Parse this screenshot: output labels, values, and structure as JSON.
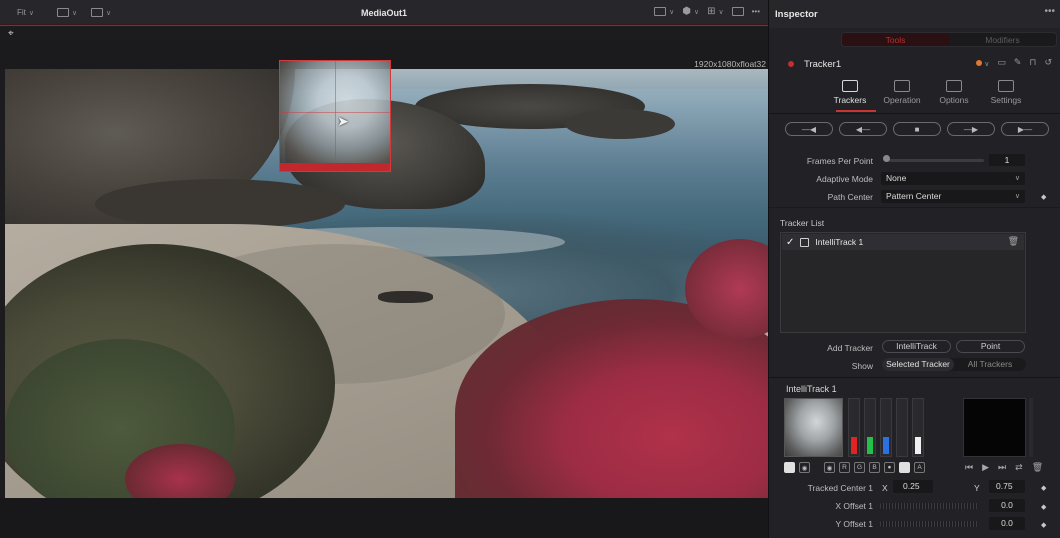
{
  "viewer": {
    "fit_label": "Fit",
    "title": "MediaOut1",
    "more_label": "•••",
    "resolution": "1920x1080xfloat32"
  },
  "inspector": {
    "title": "Inspector",
    "more_label": "•••",
    "tabs": [
      {
        "label": "Tools",
        "active": true
      },
      {
        "label": "Modifiers",
        "active": false
      }
    ],
    "node_name": "Tracker1",
    "subtabs": [
      {
        "label": "Trackers",
        "icon": "target-icon",
        "active": true
      },
      {
        "label": "Operation",
        "icon": "operation-icon",
        "active": false
      },
      {
        "label": "Options",
        "icon": "monitor-icon",
        "active": false
      },
      {
        "label": "Settings",
        "icon": "settings-icon",
        "active": false
      }
    ],
    "track_buttons": [
      {
        "name": "track-reverse-from-end",
        "glyph": "—◀"
      },
      {
        "name": "track-reverse",
        "glyph": "◀—"
      },
      {
        "name": "stop-tracking",
        "glyph": "■"
      },
      {
        "name": "track-forward",
        "glyph": "—▶"
      },
      {
        "name": "track-forward-from-start",
        "glyph": "▶—"
      }
    ],
    "frames_per_point": {
      "label": "Frames Per Point",
      "value": "1"
    },
    "adaptive_mode": {
      "label": "Adaptive Mode",
      "value": "None"
    },
    "path_center": {
      "label": "Path Center",
      "value": "Pattern Center"
    },
    "tracker_list": {
      "label": "Tracker List",
      "items": [
        {
          "name": "IntelliTrack 1",
          "checked": true
        }
      ]
    },
    "add_tracker": {
      "label": "Add Tracker",
      "intellitrack": "IntelliTrack",
      "point": "Point"
    },
    "show": {
      "label": "Show",
      "selected": "Selected Tracker",
      "all": "All Trackers"
    },
    "intellitrack": {
      "title": "IntelliTrack 1",
      "channel_letters": [
        "R",
        "G",
        "B",
        "A"
      ],
      "meters": [
        {
          "channel": "red",
          "color": "#e02424",
          "level": 0.3
        },
        {
          "channel": "green",
          "color": "#22c24a",
          "level": 0.3
        },
        {
          "channel": "blue",
          "color": "#2a72e0",
          "level": 0.3
        },
        {
          "channel": "empty",
          "color": "#2a2a2e",
          "level": 0.0
        },
        {
          "channel": "white",
          "color": "#f0f0f0",
          "level": 0.3
        }
      ],
      "tracked_center": {
        "label": "Tracked Center 1",
        "x_label": "X",
        "x": "0.25",
        "y_label": "Y",
        "y": "0.75"
      },
      "x_offset": {
        "label": "X Offset 1",
        "value": "0.0"
      },
      "y_offset": {
        "label": "Y Offset 1",
        "value": "0.0"
      }
    }
  },
  "colors": {
    "accent_red": "#c03030",
    "orange_dot": "#e1782d"
  }
}
